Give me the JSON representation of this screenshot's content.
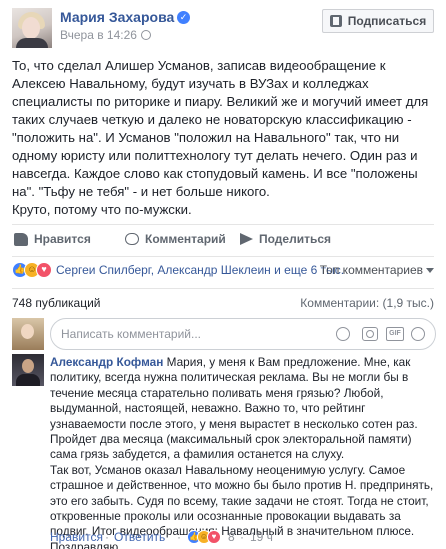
{
  "post": {
    "author": "Мария Захарова",
    "time": "Вчера в 14:26",
    "subscribe_label": "Подписаться",
    "paragraphs": [
      "То, что сделал Алишер Усманов, записав видеообращение к Алексею Навальному, будут изучать в ВУЗах и колледжах специалисты по риторике и пиару. Великий же и могучий имеет для таких случаев четкую и далеко не новаторскую классификацию - \"положить на\". И Усманов \"положил на Навального\" так, что ни одному юристу или политтехнологу тут делать нечего. Один раз и навсегда. Каждое слово как стопудовый камень. И все \"положены на\". \"Тьфу не тебя\" - и нет больше никого.",
      "Круто, потому что по-мужски."
    ]
  },
  "actions": {
    "like": "Нравится",
    "comment": "Комментарий",
    "share": "Поделиться"
  },
  "reactions": {
    "names": "Сергеи Спилберг, Александр Шеклеин и еще 6 тыс.",
    "sort": "Топ комментариев"
  },
  "counts": {
    "shares": "748 публикаций",
    "comments": "Комментарии: (1,9 тыс.)"
  },
  "comment_box": {
    "placeholder": "Написать комментарий...",
    "gif": "GIF"
  },
  "comment": {
    "author": "Александр Кофман",
    "text_1": "Мария, у меня к Вам предложение. Мне, как политику, всегда нужна политическая реклама. Вы не могли бы в течение месяца старательно поливать меня грязью? Любой, выдуманной, настоящей, неважно. Важно то, что рейтинг узнаваемости после этого, у меня вырастет в несколько сотен раз. Пройдет два месяца (максимальный срок электоральной памяти) сама грязь забудется, а фамилия останется на слуху.",
    "text_2": "Так вот, Усманов оказал Навальному неоценимую услугу. Самое страшное и действенное, что можно бы было против Н. предпринять, это его забыть. Судя по всему, такие задачи не стоят. Тогда не стоит, откровенные проколы или осознанные провокации выдавать за подвиг. Итог видеообращения: Навальный в значительном плюсе. Поздравляю.",
    "like": "Нравится",
    "reply": "Ответить",
    "reaction_count": "8",
    "time": "19 ч"
  },
  "colors": {
    "link": "#365899",
    "like_blue": "#4080ff",
    "love": "#f25268",
    "haha": "#f7b125"
  }
}
